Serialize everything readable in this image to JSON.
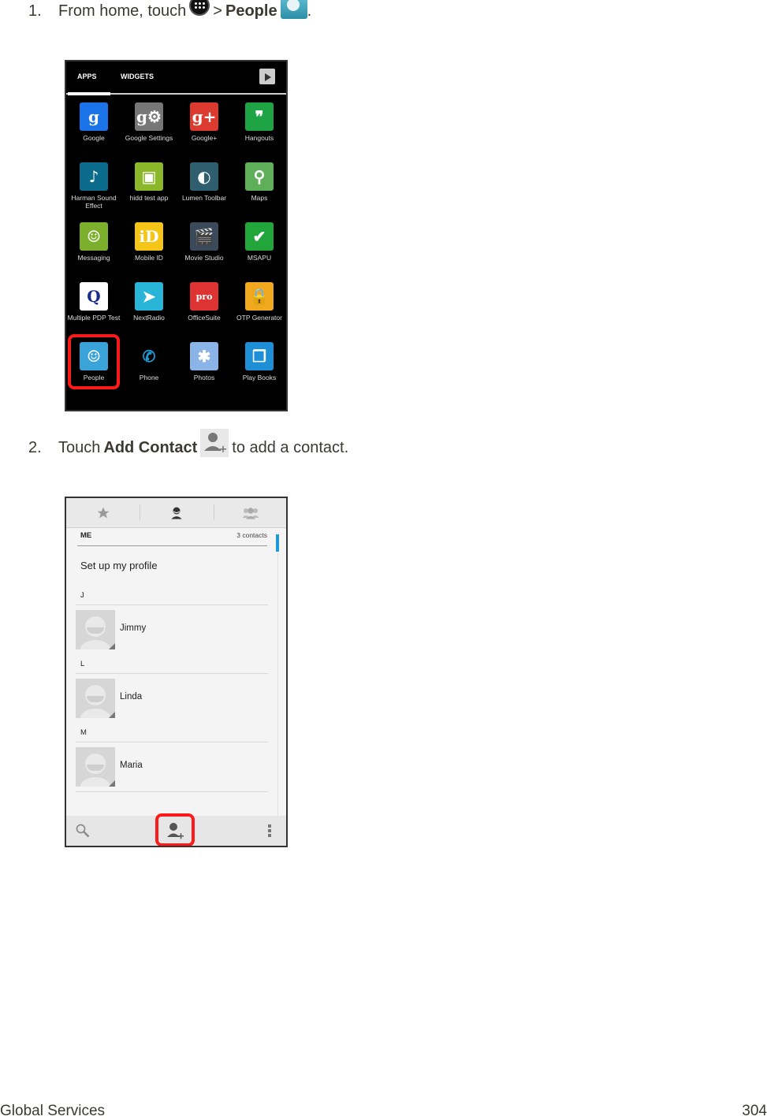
{
  "steps": [
    {
      "number": "1.",
      "text_before": "From home, touch",
      "separator": ">",
      "bold": "People",
      "text_after": ".",
      "icons": [
        "apps-launcher-icon",
        "people-app-icon"
      ]
    },
    {
      "number": "2.",
      "text_before": "Touch",
      "bold": "Add Contact",
      "text_after": "to add a contact.",
      "icons": [
        "add-contact-icon"
      ]
    }
  ],
  "app_drawer": {
    "tabs": [
      "APPS",
      "WIDGETS"
    ],
    "active_tab": "APPS",
    "store_icon": "play-store-icon",
    "apps": [
      {
        "label": "Google",
        "icon": "google-icon",
        "color": "#1a73e8",
        "glyph": "g"
      },
      {
        "label": "Google Settings",
        "icon": "google-settings-icon",
        "color": "#777777",
        "glyph": "g⚙"
      },
      {
        "label": "Google+",
        "icon": "google-plus-icon",
        "color": "#dd3b2f",
        "glyph": "g+"
      },
      {
        "label": "Hangouts",
        "icon": "hangouts-icon",
        "color": "#1fa445",
        "glyph": "❞"
      },
      {
        "label": "Harman Sound Effect",
        "icon": "harman-icon",
        "color": "#0a6b8a",
        "glyph": "♪"
      },
      {
        "label": "hidd test app",
        "icon": "cube-icon",
        "color": "#8bb82b",
        "glyph": "▣"
      },
      {
        "label": "Lumen Toolbar",
        "icon": "globe-icon",
        "color": "#2f5f6f",
        "glyph": "◐"
      },
      {
        "label": "Maps",
        "icon": "maps-icon",
        "color": "#5fae5a",
        "glyph": "⚲"
      },
      {
        "label": "Messaging",
        "icon": "messaging-icon",
        "color": "#7cb02c",
        "glyph": "☺"
      },
      {
        "label": "Mobile ID",
        "icon": "mobile-id-icon",
        "color": "#f5c518",
        "glyph": "iD"
      },
      {
        "label": "Movie Studio",
        "icon": "clapper-icon",
        "color": "#3b4a5a",
        "glyph": "🎬"
      },
      {
        "label": "MSAPU",
        "icon": "checkmark-icon",
        "color": "#22a63b",
        "glyph": "✔"
      },
      {
        "label": "Multiple PDP Test",
        "icon": "qualcomm-icon",
        "color": "#ffffff",
        "glyph": "Q"
      },
      {
        "label": "NextRadio",
        "icon": "nextradio-icon",
        "color": "#28b5d8",
        "glyph": "➤"
      },
      {
        "label": "OfficeSuite",
        "icon": "officesuite-icon",
        "color": "#d33",
        "glyph": "pro"
      },
      {
        "label": "OTP Generator",
        "icon": "padlock-icon",
        "color": "#f0a81e",
        "glyph": "🔒"
      },
      {
        "label": "People",
        "icon": "people-icon",
        "color": "#3aa3d9",
        "glyph": "☺",
        "highlighted": true
      },
      {
        "label": "Phone",
        "icon": "phone-icon",
        "color": "#000000",
        "glyph": "✆"
      },
      {
        "label": "Photos",
        "icon": "photos-icon",
        "color": "#8ab4e8",
        "glyph": "✱"
      },
      {
        "label": "Play Books",
        "icon": "play-books-icon",
        "color": "#1e8fd6",
        "glyph": "❒"
      }
    ]
  },
  "people_app": {
    "tabs": [
      "favorites-star-icon",
      "contacts-person-icon",
      "groups-icon"
    ],
    "me_header": "ME",
    "contact_count": "3 contacts",
    "setup_profile": "Set up my profile",
    "sections": [
      {
        "letter": "J",
        "contacts": [
          "Jimmy"
        ]
      },
      {
        "letter": "L",
        "contacts": [
          "Linda"
        ]
      },
      {
        "letter": "M",
        "contacts": [
          "Maria"
        ]
      }
    ],
    "bottom_bar": [
      "search-icon",
      "add-contact-icon",
      "overflow-menu-icon"
    ],
    "highlight_color": "#ff1a1a",
    "accent_color": "#1e9bd7"
  },
  "footer": {
    "section": "Global Services",
    "page": "304"
  }
}
